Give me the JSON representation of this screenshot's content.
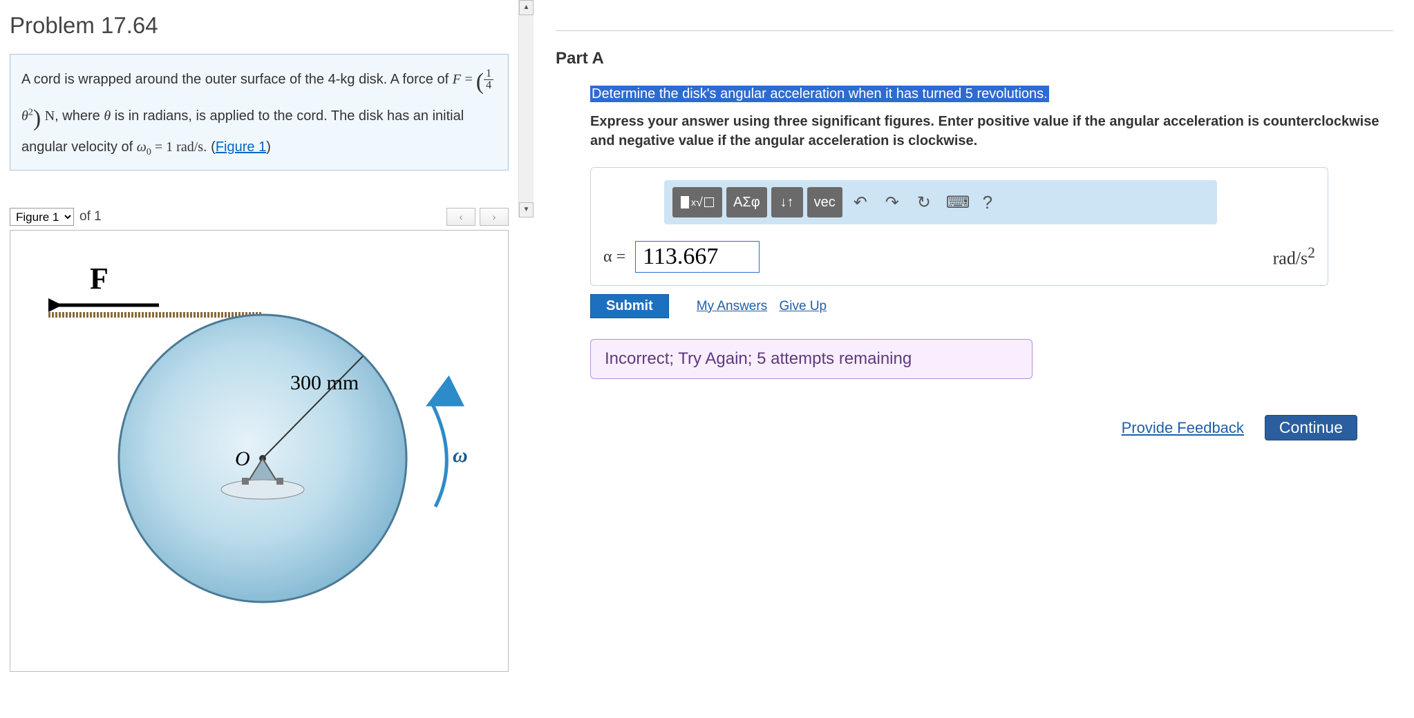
{
  "problem": {
    "title": "Problem 17.64",
    "text_before_force": "A cord is wrapped around the outer surface of the 4-kg disk. A force of ",
    "force_var": "F",
    "force_frac_num": "1",
    "force_frac_den": "4",
    "force_theta": "θ",
    "force_exp": "2",
    "force_unit": "N",
    "text_where": ", where ",
    "theta_var": "θ",
    "text_after_theta": " is in radians, is applied to the cord. The disk has an initial angular velocity of ",
    "omega_var": "ω",
    "omega_sub": "0",
    "omega_val": " = 1 rad/s",
    "figure_link": "Figure 1"
  },
  "figure": {
    "select_label": "Figure 1",
    "of_text": "of 1",
    "prev": "‹",
    "next": "›",
    "force_label": "F",
    "radius_label": "300 mm",
    "center_label": "O",
    "omega_label": "ω"
  },
  "partA": {
    "heading": "Part A",
    "prompt": "Determine the disk's angular acceleration when it has turned 5 revolutions.",
    "instructions": "Express your answer using three significant figures. Enter positive value if the angular acceleration is counterclockwise and negative value if the angular acceleration is clockwise.",
    "toolbar": {
      "templates": "▮√▯",
      "greek": "ΑΣφ",
      "sort": "↓↑",
      "vec": "vec",
      "undo_title": "Undo",
      "redo_title": "Redo",
      "reset_title": "Reset",
      "keyboard_title": "Keyboard",
      "help": "?"
    },
    "alpha_label": "α = ",
    "answer_value": "113.667",
    "unit": "rad/s²",
    "submit": "Submit",
    "my_answers": "My Answers",
    "give_up": "Give Up",
    "feedback": "Incorrect; Try Again; 5 attempts remaining"
  },
  "footer": {
    "provide_feedback": "Provide Feedback",
    "continue": "Continue"
  }
}
